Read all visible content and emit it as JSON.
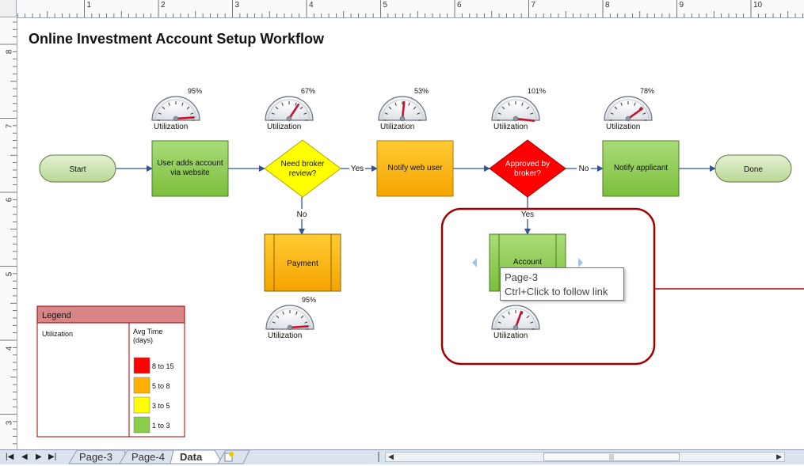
{
  "title": "Online Investment Account Setup Workflow",
  "ruler": {
    "top_numbers": [
      "1",
      "2",
      "3",
      "4",
      "5",
      "6",
      "7",
      "8",
      "9",
      "10"
    ],
    "left_numbers": [
      "8",
      "7",
      "6",
      "5",
      "4",
      "3"
    ]
  },
  "nodes": {
    "start": "Start",
    "user_adds": "User adds account via website",
    "need_broker": "Need broker review?",
    "notify_web": "Notify web user",
    "approved": "Approved by broker?",
    "notify_applicant": "Notify applicant",
    "done": "Done",
    "payment": "Payment",
    "account": "Account"
  },
  "edge_labels": {
    "yes1": "Yes",
    "no1": "No",
    "no2": "No",
    "yes2": "Yes"
  },
  "gauges": {
    "label": "Utilization",
    "g1": "95%",
    "g2": "67%",
    "g3": "53%",
    "g4": "101%",
    "g5": "78%",
    "g6": "95%"
  },
  "legend": {
    "title": "Legend",
    "col1": "Utilization",
    "col2": "Avg Time (days)",
    "items": [
      {
        "label": "8 to 15",
        "color": "#ff0000"
      },
      {
        "label": "5 to 8",
        "color": "#ffb000"
      },
      {
        "label": "3 to 5",
        "color": "#ffff00"
      },
      {
        "label": "1 to 3",
        "color": "#8ccc4a"
      }
    ]
  },
  "tooltip": {
    "line1": "Page-3",
    "line2": "Ctrl+Click to follow link"
  },
  "tabs": [
    "Page-3",
    "Page-4",
    "Data"
  ],
  "colors": {
    "green": "#8ccc4a",
    "yellow": "#ffff00",
    "orange": "#ffb000",
    "red": "#ff0000",
    "terminator": "#cfe3b4",
    "arrow": "#2f5597",
    "callout": "#a00000"
  }
}
